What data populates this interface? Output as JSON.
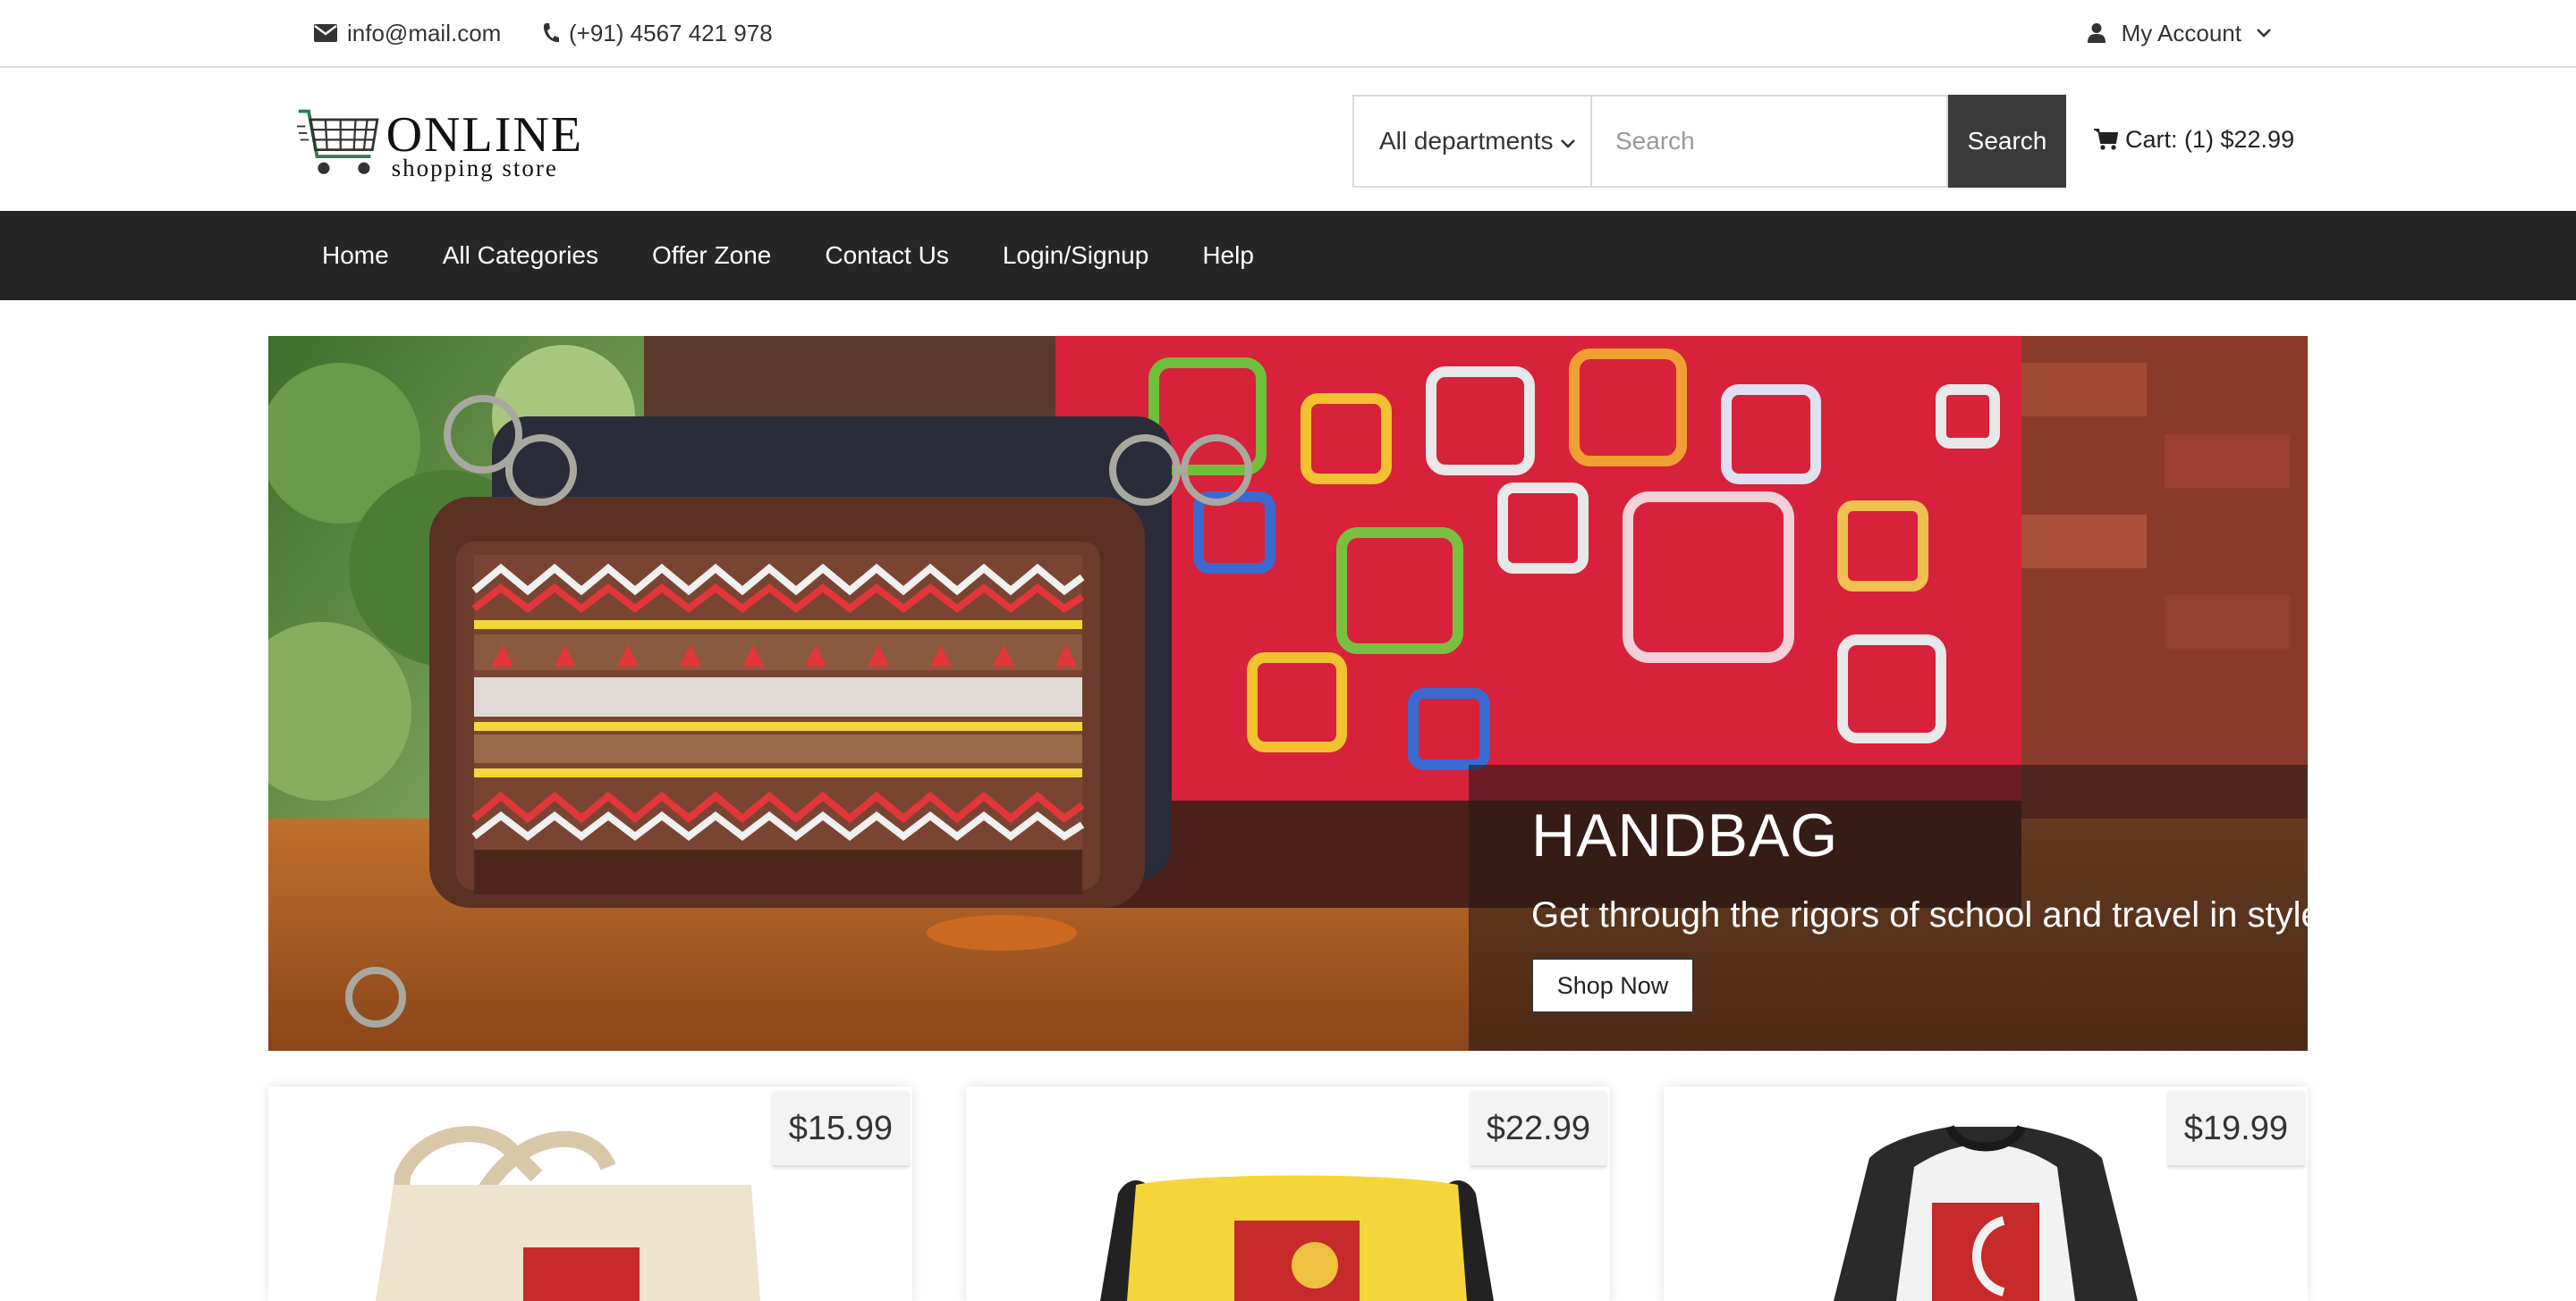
{
  "topbar": {
    "email": "info@mail.com",
    "phone": "(+91) 4567 421 978",
    "account_label": "My Account",
    "icons": {
      "email": "envelope-icon",
      "phone": "phone-icon",
      "account": "user-icon",
      "chevron": "chevron-down-icon"
    }
  },
  "header": {
    "logo_big": "ONLINE",
    "logo_small": "shopping store",
    "department_selected": "All departments",
    "search_placeholder": "Search",
    "search_button": "Search",
    "cart_label": "Cart: (1) $22.99"
  },
  "nav": {
    "items": [
      "Home",
      "All Categories",
      "Offer Zone",
      "Contact Us",
      "Login/Signup",
      "Help"
    ]
  },
  "hero": {
    "title": "HANDBAG",
    "subtitle": "Get through the rigors of school and travel in style",
    "button": "Shop Now"
  },
  "products": [
    {
      "price": "$15.99",
      "item": "tote-bag"
    },
    {
      "price": "$22.99",
      "item": "messenger-bag"
    },
    {
      "price": "$19.99",
      "item": "raglan-shirt"
    }
  ],
  "colors": {
    "nav_bg": "#262626",
    "search_button_bg": "#3a3a3a",
    "hero_caption_bg": "rgba(40,26,22,0.62)"
  }
}
